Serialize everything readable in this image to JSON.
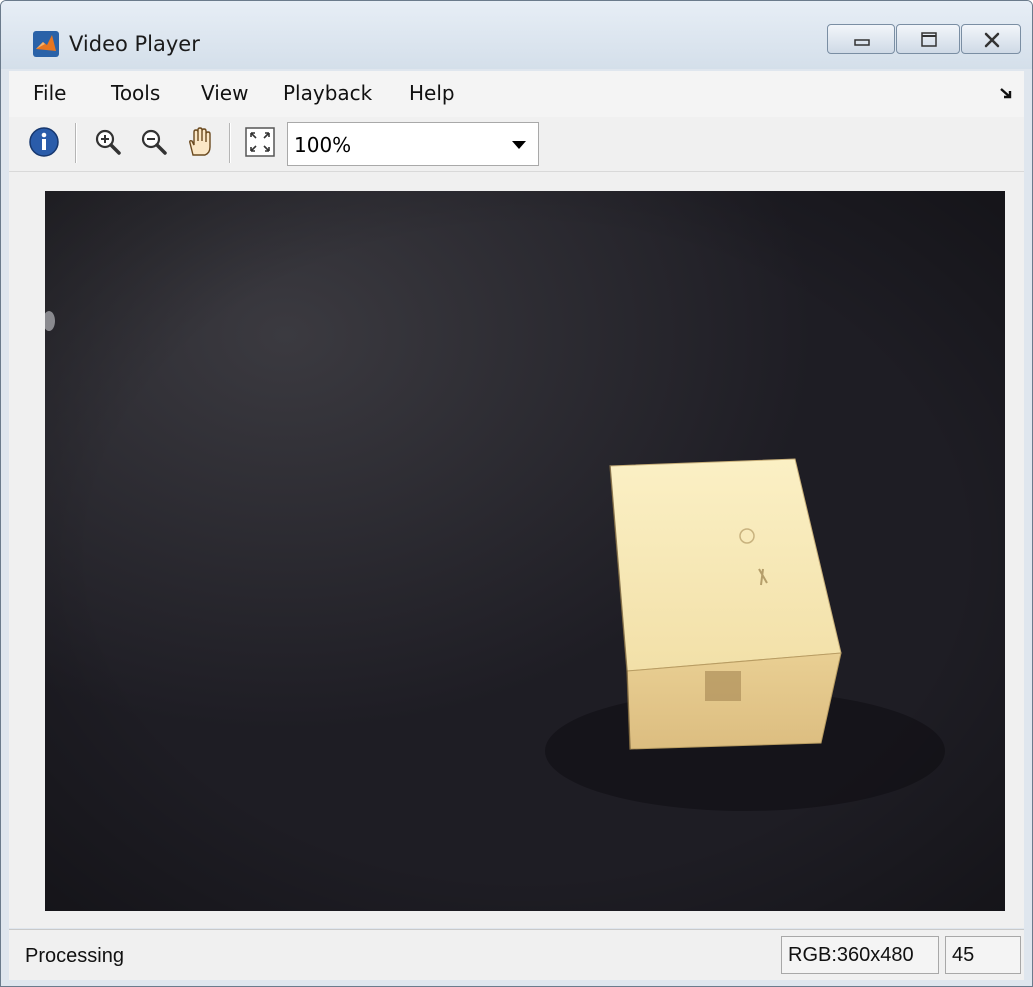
{
  "window": {
    "title": "Video Player",
    "title_icon": "matlab-logo-icon",
    "controls": [
      "minimize-icon",
      "maximize-icon",
      "close-icon"
    ]
  },
  "menubar": {
    "items": [
      {
        "label": "File"
      },
      {
        "label": "Tools"
      },
      {
        "label": "View"
      },
      {
        "label": "Playback"
      },
      {
        "label": "Help"
      }
    ],
    "dock_icon": "undock-arrow-icon"
  },
  "toolbar": {
    "buttons": [
      "info-icon",
      "zoom-in-icon",
      "zoom-out-icon",
      "pan-hand-icon",
      "fit-to-window-icon"
    ],
    "zoom_level": "100%"
  },
  "video": {
    "content": "camera frame of a cardboard box on a dark carpet"
  },
  "statusbar": {
    "status": "Processing",
    "video_info": "RGB:360x480",
    "frame_number": "45"
  },
  "colors": {
    "titlebar": "#dbe5ef",
    "chrome": "#f0f0f0",
    "video_background": "#1d1c23",
    "box": "#f3e3b0"
  }
}
